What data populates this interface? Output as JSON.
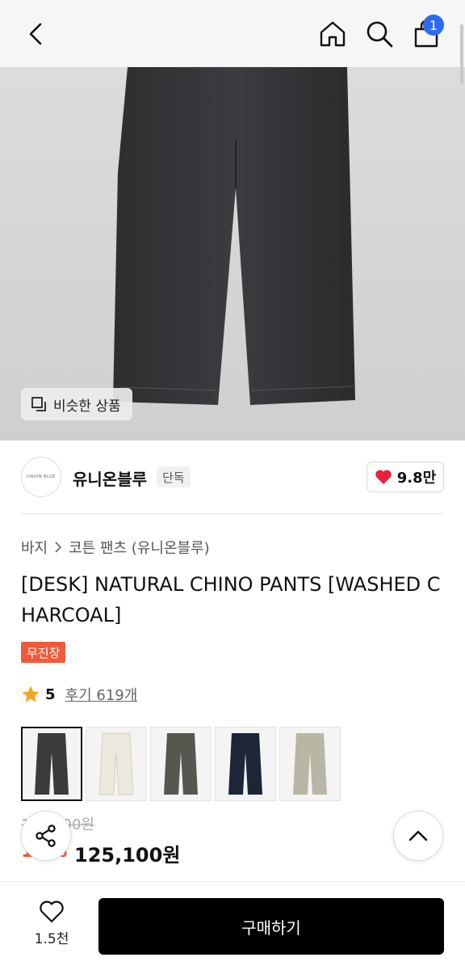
{
  "header": {
    "back_icon": "chevron-left-icon",
    "home_icon": "home-icon",
    "search_icon": "search-icon",
    "bag_icon": "shopping-bag-icon",
    "bag_count": "1"
  },
  "hero": {
    "similar_label": "비슷한 상품",
    "similar_icon": "similar-products-icon"
  },
  "brand": {
    "logo_text": "UNION BLUE",
    "name": "유니온블루",
    "exclusive_label": "단독",
    "likes": "9.8만",
    "like_color": "#e8223a"
  },
  "breadcrumb": {
    "items": [
      "바지",
      "코튼 팬츠 (유니온블루)"
    ]
  },
  "product": {
    "title": "[DESK] NATURAL CHINO PANTS [WASHED CHARCOAL]",
    "tag": "무진장",
    "tag_color": "#f05a3a",
    "rating": "5",
    "reviews": "후기 619개"
  },
  "swatches": [
    {
      "name": "charcoal",
      "color": "#3a3b3d",
      "selected": true
    },
    {
      "name": "ivory",
      "color": "#ece8dd",
      "selected": false
    },
    {
      "name": "olive",
      "color": "#54584f",
      "selected": false
    },
    {
      "name": "navy",
      "color": "#1c2638",
      "selected": false
    },
    {
      "name": "beige",
      "color": "#b9b6a6",
      "selected": false
    }
  ],
  "price": {
    "original": "139,000원",
    "discount": "10%",
    "final": "125,100원"
  },
  "bottom": {
    "wish_count": "1.5천",
    "buy_label": "구매하기"
  }
}
